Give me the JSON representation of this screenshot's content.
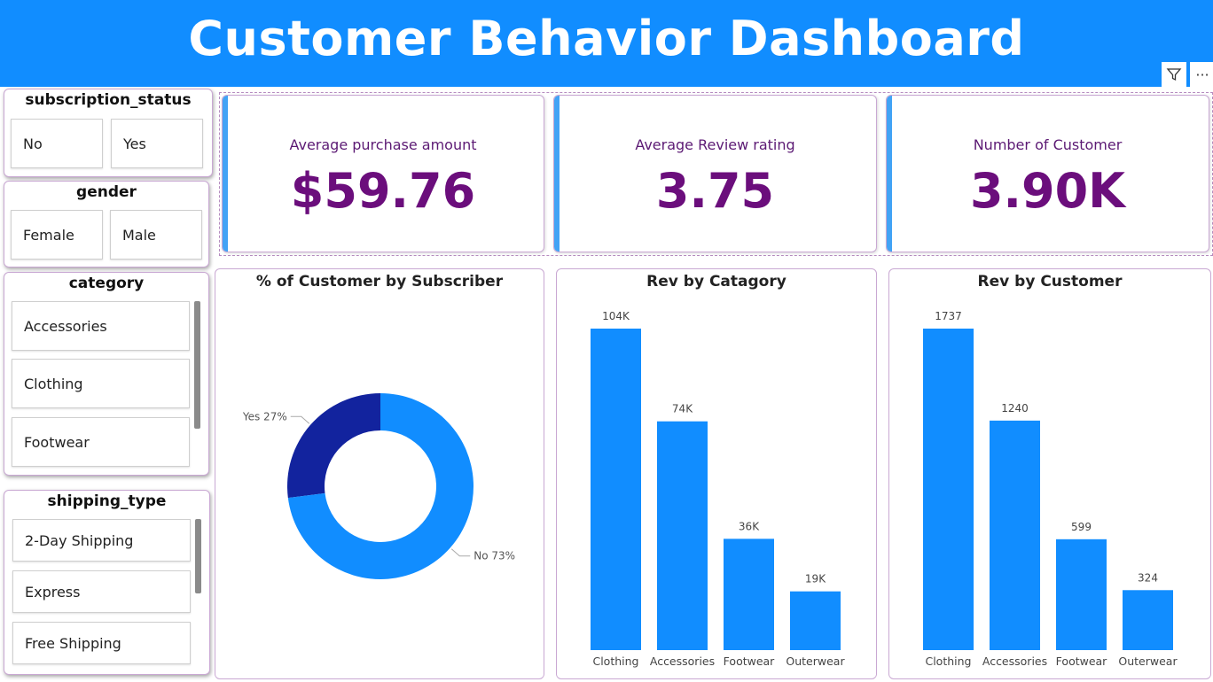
{
  "header": {
    "title": "Customer Behavior Dashboard"
  },
  "toolbar": {
    "filter_icon": "filter-icon",
    "more_icon": "more-options-icon",
    "more_glyph": "···"
  },
  "slicers": {
    "subscription": {
      "title": "subscription_status",
      "options": [
        "No",
        "Yes"
      ]
    },
    "gender": {
      "title": "gender",
      "options": [
        "Female",
        "Male"
      ]
    },
    "category": {
      "title": "category",
      "options": [
        "Accessories",
        "Clothing",
        "Footwear"
      ]
    },
    "shipping": {
      "title": "shipping_type",
      "options": [
        "2-Day Shipping",
        "Express",
        "Free Shipping"
      ]
    }
  },
  "kpis": [
    {
      "label": "Average purchase amount",
      "value": "$59.76"
    },
    {
      "label": "Average Review rating",
      "value": "3.75"
    },
    {
      "label": "Number of Customer",
      "value": "3.90K"
    }
  ],
  "colors": {
    "accent": "#118dff",
    "dark": "#12239e",
    "kpi_text": "#6b0e7c"
  },
  "chart_data": [
    {
      "type": "pie",
      "title": "% of Customer by Subscriber",
      "categories": [
        "Yes",
        "No"
      ],
      "values": [
        27,
        73
      ],
      "labels": [
        "Yes 27%",
        "No 73%"
      ],
      "colors": [
        "#12239e",
        "#118dff"
      ]
    },
    {
      "type": "bar",
      "title": "Rev by Catagory",
      "categories": [
        "Clothing",
        "Accessories",
        "Footwear",
        "Outerwear"
      ],
      "values": [
        104000,
        74000,
        36000,
        19000
      ],
      "data_labels": [
        "104K",
        "74K",
        "36K",
        "19K"
      ]
    },
    {
      "type": "bar",
      "title": "Rev by Customer",
      "categories": [
        "Clothing",
        "Accessories",
        "Footwear",
        "Outerwear"
      ],
      "values": [
        1737,
        1240,
        599,
        324
      ],
      "data_labels": [
        "1737",
        "1240",
        "599",
        "324"
      ]
    }
  ]
}
